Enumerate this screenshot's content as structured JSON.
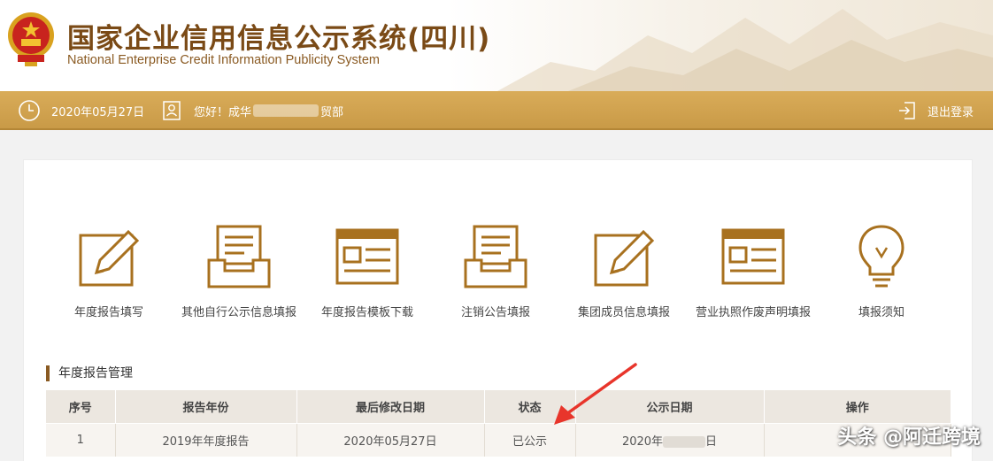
{
  "header": {
    "title": "国家企业信用信息公示系统(四川)",
    "subtitle": "National Enterprise Credit Information Publicity System"
  },
  "toolbar": {
    "date": "2020年05月27日",
    "greeting_prefix": "您好！成华",
    "greeting_suffix": "贸部",
    "logout": "退出登录"
  },
  "functions": [
    {
      "label": "年度报告填写",
      "icon": "edit-icon"
    },
    {
      "label": "其他自行公示信息填报",
      "icon": "inbox-tray-icon"
    },
    {
      "label": "年度报告模板下载",
      "icon": "template-window-icon"
    },
    {
      "label": "注销公告填报",
      "icon": "inbox-tray-icon"
    },
    {
      "label": "集团成员信息填报",
      "icon": "edit-icon"
    },
    {
      "label": "营业执照作废声明填报",
      "icon": "template-window-icon"
    },
    {
      "label": "填报须知",
      "icon": "lightbulb-icon"
    }
  ],
  "section": {
    "title": "年度报告管理"
  },
  "table": {
    "headers": [
      "序号",
      "报告年份",
      "最后修改日期",
      "状态",
      "公示日期",
      "操作"
    ],
    "rows": [
      {
        "index": "1",
        "year": "2019年年度报告",
        "modified": "2020年05月27日",
        "status": "已公示",
        "publish_prefix": "2020年",
        "publish_suffix": "日"
      }
    ]
  },
  "watermark": "头条 @阿迁跨境",
  "colors": {
    "brand_brown": "#7a4a16",
    "toolbar_gold": "#d0a24f",
    "arrow_red": "#e8352b"
  }
}
